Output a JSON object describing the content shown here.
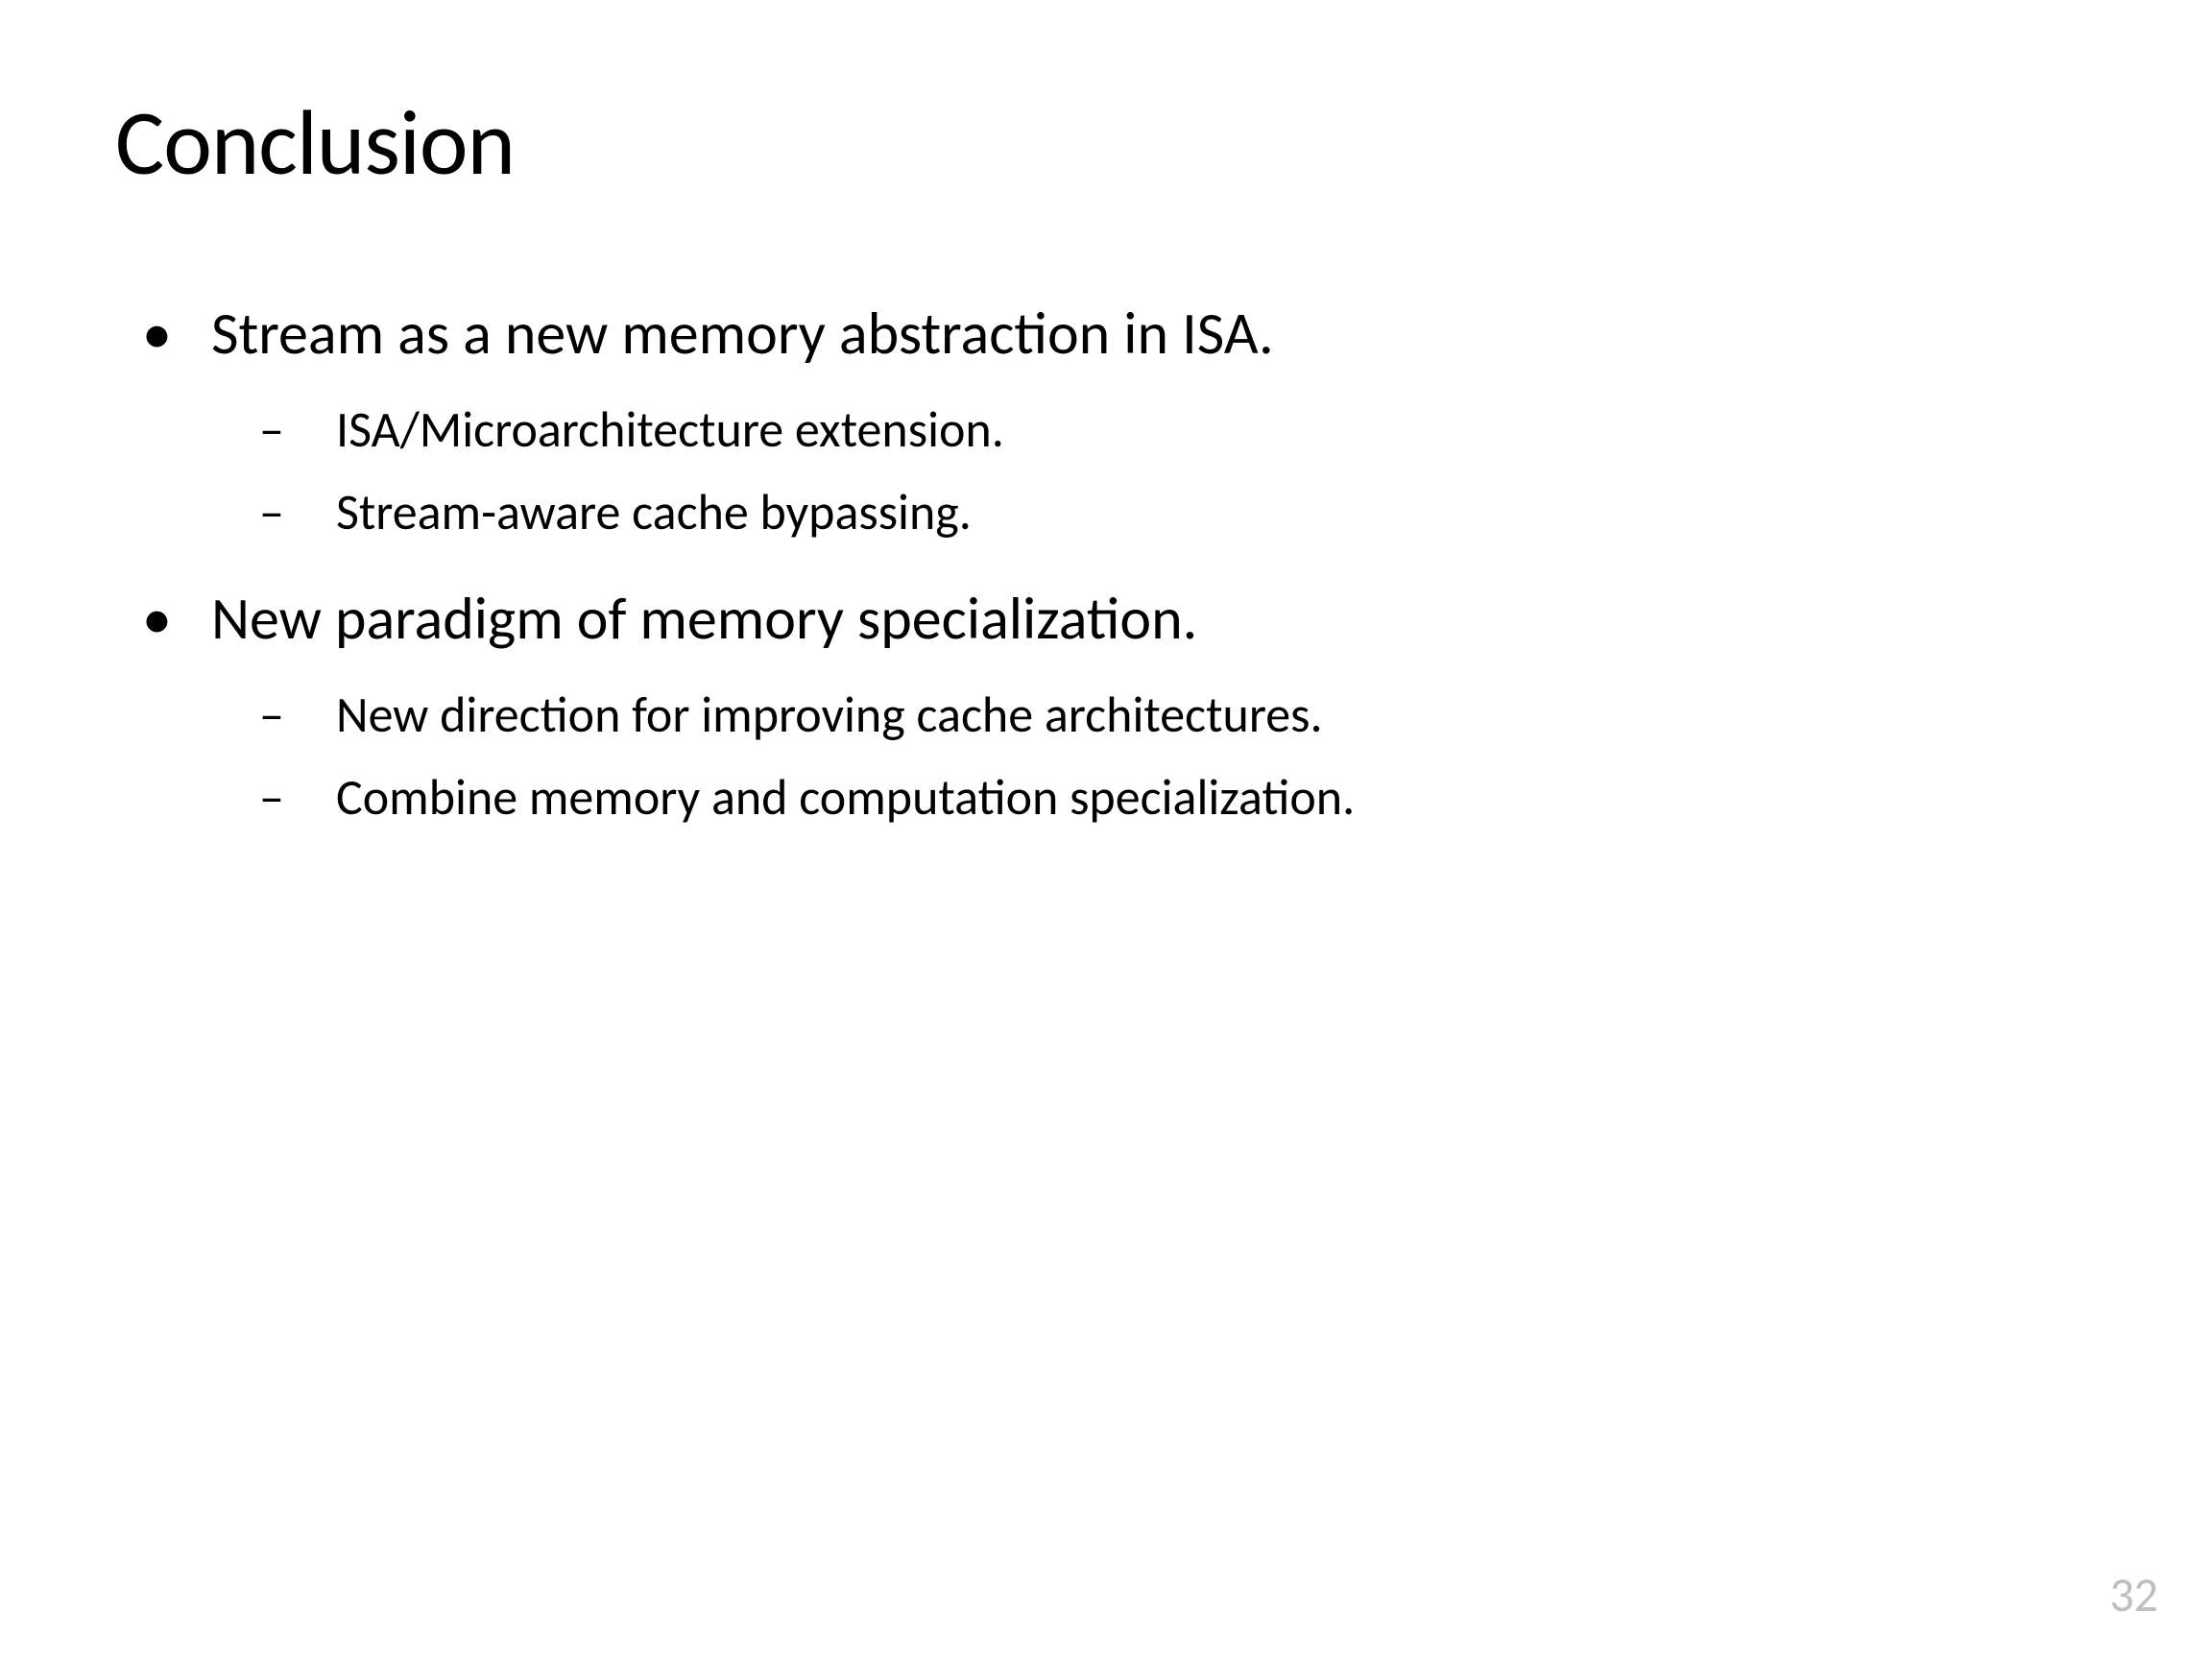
{
  "slide": {
    "title": "Conclusion",
    "bullets": [
      {
        "text": "Stream as a new memory abstraction in ISA.",
        "children": [
          "ISA/Microarchitecture extension.",
          "Stream-aware cache bypassing."
        ]
      },
      {
        "text": "New paradigm of memory specialization.",
        "children": [
          "New direction for improving cache architectures.",
          "Combine memory and computation specialization."
        ]
      }
    ],
    "page_number": "32"
  }
}
